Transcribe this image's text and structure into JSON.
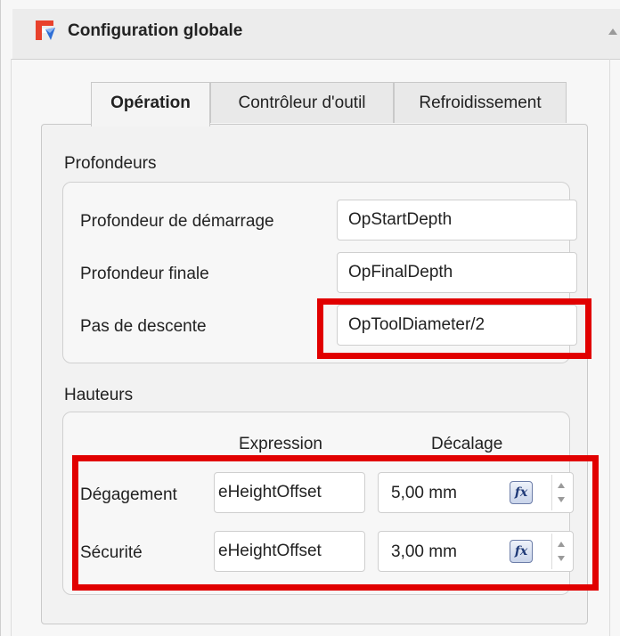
{
  "panel": {
    "title": "Configuration globale"
  },
  "tabs": [
    {
      "label": "Opération",
      "active": true
    },
    {
      "label": "Contrôleur d'outil",
      "active": false
    },
    {
      "label": "Refroidissement",
      "active": false
    }
  ],
  "depths": {
    "title": "Profondeurs",
    "rows": [
      {
        "label": "Profondeur de démarrage",
        "value": "OpStartDepth"
      },
      {
        "label": "Profondeur finale",
        "value": "OpFinalDepth"
      },
      {
        "label": "Pas de descente",
        "value": "OpToolDiameter/2"
      }
    ]
  },
  "heights": {
    "title": "Hauteurs",
    "col_expression": "Expression",
    "col_offset": "Décalage",
    "rows": [
      {
        "label": "Dégagement",
        "expression": "eHeightOffset",
        "offset": "5,00 mm"
      },
      {
        "label": "Sécurité",
        "expression": "eHeightOffset",
        "offset": "3,00 mm"
      }
    ]
  },
  "fx_label": "fx",
  "colors": {
    "highlight": "#e10000",
    "logo_red": "#e8412c",
    "logo_blue": "#2f6fd6"
  },
  "icons": {
    "logo": "app-logo-icon",
    "collapse": "collapse-arrow-icon",
    "fx": "fx-icon",
    "spin_up": "spin-up-icon",
    "spin_down": "spin-down-icon"
  }
}
